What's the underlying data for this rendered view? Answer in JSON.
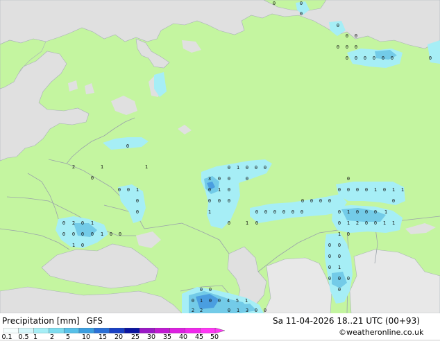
{
  "title": {
    "left": "Precipitation [mm]",
    "model": "GFS",
    "datetime": "Sa 11-04-2026 18..21 UTC (00+93)",
    "credit": "©weatheronline.co.uk"
  },
  "colors": {
    "land": "#c4f5a0",
    "sea": "#e0e0e0",
    "border": "#9aa2aa",
    "precip_light": "#a6eef6",
    "precip_mid": "#73cbe8",
    "precip_heavy": "#4a9ee0"
  },
  "legend": {
    "ticks": [
      "0.1",
      "0.5",
      "1",
      "2",
      "5",
      "10",
      "15",
      "20",
      "25",
      "30",
      "35",
      "40",
      "45",
      "50"
    ],
    "colors": [
      "#f5fdfd",
      "#d4f6fa",
      "#a6eef6",
      "#7ddcef",
      "#57c0e8",
      "#3b9ee0",
      "#2a6fd6",
      "#1940c4",
      "#0a14a0",
      "#9a19c6",
      "#c01ad2",
      "#dc20e0",
      "#f028ec",
      "#ff38f5"
    ]
  },
  "value_labels": [
    {
      "text": "0"
    },
    {
      "text": "0"
    },
    {
      "text": "0"
    },
    {
      "text": "0"
    },
    {
      "text": "0"
    },
    {
      "text": "0"
    },
    {
      "text": "0"
    },
    {
      "text": "0"
    },
    {
      "text": "0"
    },
    {
      "text": "0"
    },
    {
      "text": "0"
    },
    {
      "text": "0"
    },
    {
      "text": "0"
    },
    {
      "text": "0"
    },
    {
      "text": "0"
    },
    {
      "text": "0"
    },
    {
      "text": "0"
    },
    {
      "text": "2"
    },
    {
      "text": "1"
    },
    {
      "text": "1"
    },
    {
      "text": "0"
    },
    {
      "text": "3"
    },
    {
      "text": "0"
    },
    {
      "text": "0"
    },
    {
      "text": "0"
    },
    {
      "text": "0"
    },
    {
      "text": "1"
    },
    {
      "text": "0"
    },
    {
      "text": "0"
    },
    {
      "text": "0"
    },
    {
      "text": "0"
    },
    {
      "text": "1"
    },
    {
      "text": "0"
    },
    {
      "text": "0"
    },
    {
      "text": "0"
    },
    {
      "text": "1"
    },
    {
      "text": "0"
    },
    {
      "text": "0"
    },
    {
      "text": "0"
    },
    {
      "text": "0"
    },
    {
      "text": "0"
    },
    {
      "text": "1"
    },
    {
      "text": "0"
    },
    {
      "text": "0"
    },
    {
      "text": "1"
    },
    {
      "text": "0"
    },
    {
      "text": "0"
    },
    {
      "text": "0"
    },
    {
      "text": "0"
    },
    {
      "text": "0"
    },
    {
      "text": "0"
    },
    {
      "text": "0"
    },
    {
      "text": "0"
    },
    {
      "text": "0"
    },
    {
      "text": "0"
    },
    {
      "text": "0"
    },
    {
      "text": "0"
    },
    {
      "text": "0"
    },
    {
      "text": "0"
    },
    {
      "text": "0"
    },
    {
      "text": "1"
    },
    {
      "text": "0"
    },
    {
      "text": "1"
    },
    {
      "text": "1"
    },
    {
      "text": "0"
    },
    {
      "text": "0"
    },
    {
      "text": "1"
    },
    {
      "text": "0"
    },
    {
      "text": "0"
    },
    {
      "text": "0"
    },
    {
      "text": "1"
    },
    {
      "text": "0"
    },
    {
      "text": "1"
    },
    {
      "text": "2"
    },
    {
      "text": "0"
    },
    {
      "text": "0"
    },
    {
      "text": "1"
    },
    {
      "text": "1"
    },
    {
      "text": "1"
    },
    {
      "text": "0"
    },
    {
      "text": "0"
    },
    {
      "text": "0"
    },
    {
      "text": "0"
    },
    {
      "text": "0"
    },
    {
      "text": "0"
    },
    {
      "text": "1"
    },
    {
      "text": "0"
    },
    {
      "text": "0"
    },
    {
      "text": "0"
    },
    {
      "text": "0"
    },
    {
      "text": "0"
    },
    {
      "text": "2"
    },
    {
      "text": "0"
    },
    {
      "text": "1"
    },
    {
      "text": "0"
    },
    {
      "text": "0"
    },
    {
      "text": "0"
    },
    {
      "text": "0"
    },
    {
      "text": "1"
    },
    {
      "text": "0"
    },
    {
      "text": "0"
    },
    {
      "text": "1"
    },
    {
      "text": "0"
    },
    {
      "text": "0"
    },
    {
      "text": "0"
    },
    {
      "text": "0"
    },
    {
      "text": "1"
    },
    {
      "text": "0"
    },
    {
      "text": "0"
    },
    {
      "text": "4"
    },
    {
      "text": "5"
    },
    {
      "text": "1"
    },
    {
      "text": "2"
    },
    {
      "text": "2"
    },
    {
      "text": "0"
    },
    {
      "text": "1"
    },
    {
      "text": "3"
    },
    {
      "text": "0"
    },
    {
      "text": "0"
    },
    {
      "text": "1"
    },
    {
      "text": "2"
    },
    {
      "text": "0"
    }
  ]
}
